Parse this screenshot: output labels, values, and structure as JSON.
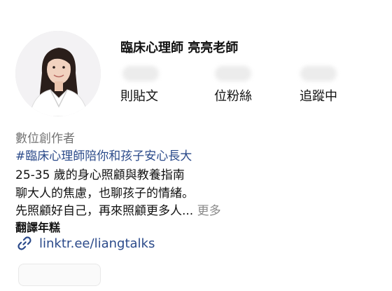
{
  "profile": {
    "display_name": "臨床心理師 亮亮老師",
    "stats": {
      "posts_label": "則貼文",
      "followers_label": "位粉絲",
      "following_label": "追蹤中"
    },
    "category": "數位創作者",
    "hashtag": "#臨床心理師陪你和孩子安心長大",
    "bio_lines": [
      "25-35 歲的身心照顧與教養指南",
      "聊大人的焦慮，也聊孩子的情緒。",
      "先照顧好自己，再來照顧更多人..."
    ],
    "more_label": "更多",
    "translate_label": "翻譯年糕",
    "link": "linktr.ee/liangtalks"
  },
  "colors": {
    "link_blue": "#2b4a8a",
    "muted_gray": "#737373"
  },
  "icons": [
    "link-icon"
  ]
}
